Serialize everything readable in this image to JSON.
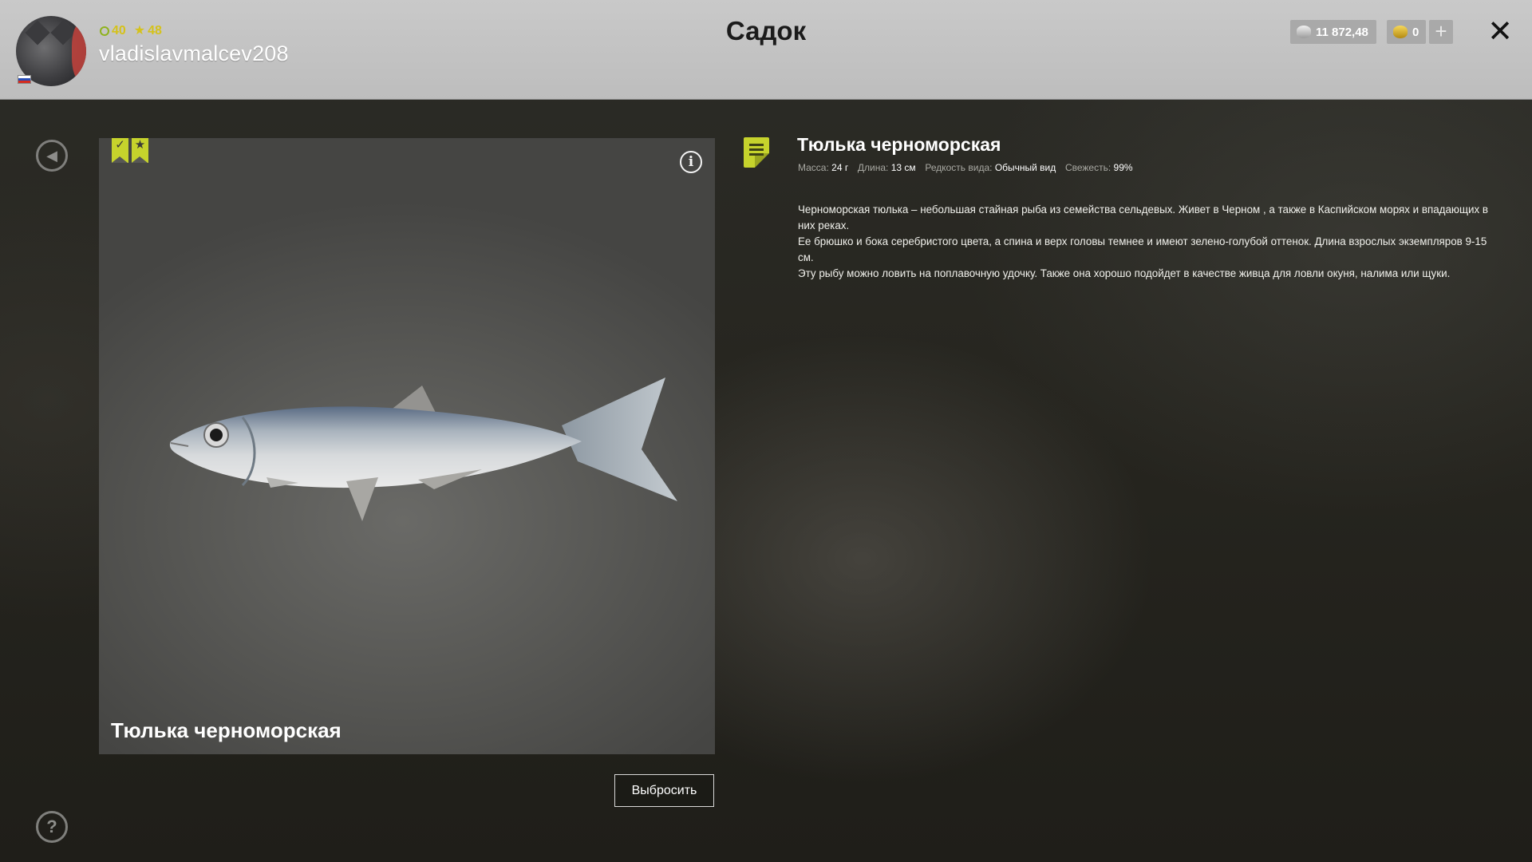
{
  "header": {
    "title": "Садок",
    "username": "vladislavmalcev208",
    "level": "40",
    "stars": "48",
    "silver": "11 872,48",
    "gold": "0",
    "plus_label": "+",
    "close_label": "✕"
  },
  "fish": {
    "name": "Тюлька черноморская",
    "card_name": "Тюлька черноморская",
    "mass_label": "Масса:",
    "mass_value": "24 г",
    "length_label": "Длина:",
    "length_value": "13 см",
    "rarity_label": "Редкость вида:",
    "rarity_value": "Обычный вид",
    "freshness_label": "Свежесть:",
    "freshness_value": "99%",
    "description": [
      "Черноморская тюлька – небольшая стайная рыба из семейства сельдевых. Живет в Черном , а также в Каспийском морях и впадающих в них реках.",
      "Ее брюшко и бока серебристого цвета, а спина и верх головы темнее и имеют зелено-голубой оттенок. Длина взрослых экземпляров 9-15 см.",
      "Эту рыбу можно ловить на поплавочную удочку. Также она хорошо подойдет в качестве живца для ловли окуня, налима или щуки."
    ]
  },
  "actions": {
    "discard_label": "Выбросить"
  },
  "icons": {
    "back": "back-icon",
    "help": "help-icon",
    "info": "info-icon",
    "doc": "document-icon",
    "check_badge": "check-badge-icon",
    "star_badge": "star-badge-icon"
  },
  "colors": {
    "accent": "#c6d32c",
    "stat_yellow": "#d5c21a",
    "topbar": "#c4c4c4"
  }
}
